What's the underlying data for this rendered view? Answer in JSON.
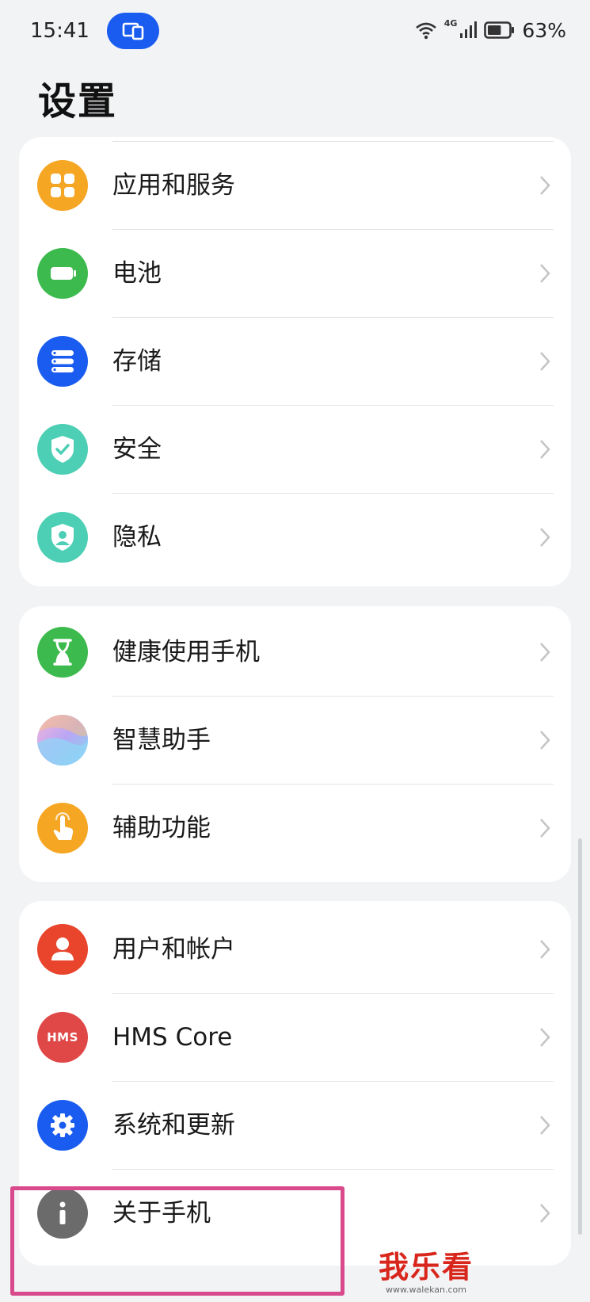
{
  "status_bar": {
    "time": "15:41",
    "battery_percent": "63%",
    "network_label": "4G",
    "battery_level": 0.63
  },
  "page": {
    "title": "设置"
  },
  "groups": [
    {
      "items": [
        {
          "label": "应用和服务",
          "icon": "apps-icon",
          "color": "#f5a623"
        },
        {
          "label": "电池",
          "icon": "battery-icon",
          "color": "#3dba4e"
        },
        {
          "label": "存储",
          "icon": "storage-icon",
          "color": "#1a5cf0"
        },
        {
          "label": "安全",
          "icon": "shield-check-icon",
          "color": "#4ccfb4"
        },
        {
          "label": "隐私",
          "icon": "privacy-icon",
          "color": "#4ccfb4"
        }
      ]
    },
    {
      "items": [
        {
          "label": "健康使用手机",
          "icon": "hourglass-icon",
          "color": "#3dba4e"
        },
        {
          "label": "智慧助手",
          "icon": "assistant-icon",
          "color": "#c6a0f0"
        },
        {
          "label": "辅助功能",
          "icon": "accessibility-hand-icon",
          "color": "#f5a623"
        }
      ]
    },
    {
      "items": [
        {
          "label": "用户和帐户",
          "icon": "user-icon",
          "color": "#e8452c"
        },
        {
          "label": "HMS Core",
          "icon": "hms-icon",
          "icon_text": "HMS",
          "color": "#e04848"
        },
        {
          "label": "系统和更新",
          "icon": "gear-icon",
          "color": "#1a5cf0"
        },
        {
          "label": "关于手机",
          "icon": "info-icon",
          "color": "#6b6b6b"
        }
      ]
    }
  ],
  "watermark": {
    "text": "我乐看",
    "url": "www.walekan.com"
  },
  "colors": {
    "background": "#f1f3f5",
    "card": "#ffffff",
    "highlight": "#d94a8c",
    "accent": "#1a5cf0"
  }
}
